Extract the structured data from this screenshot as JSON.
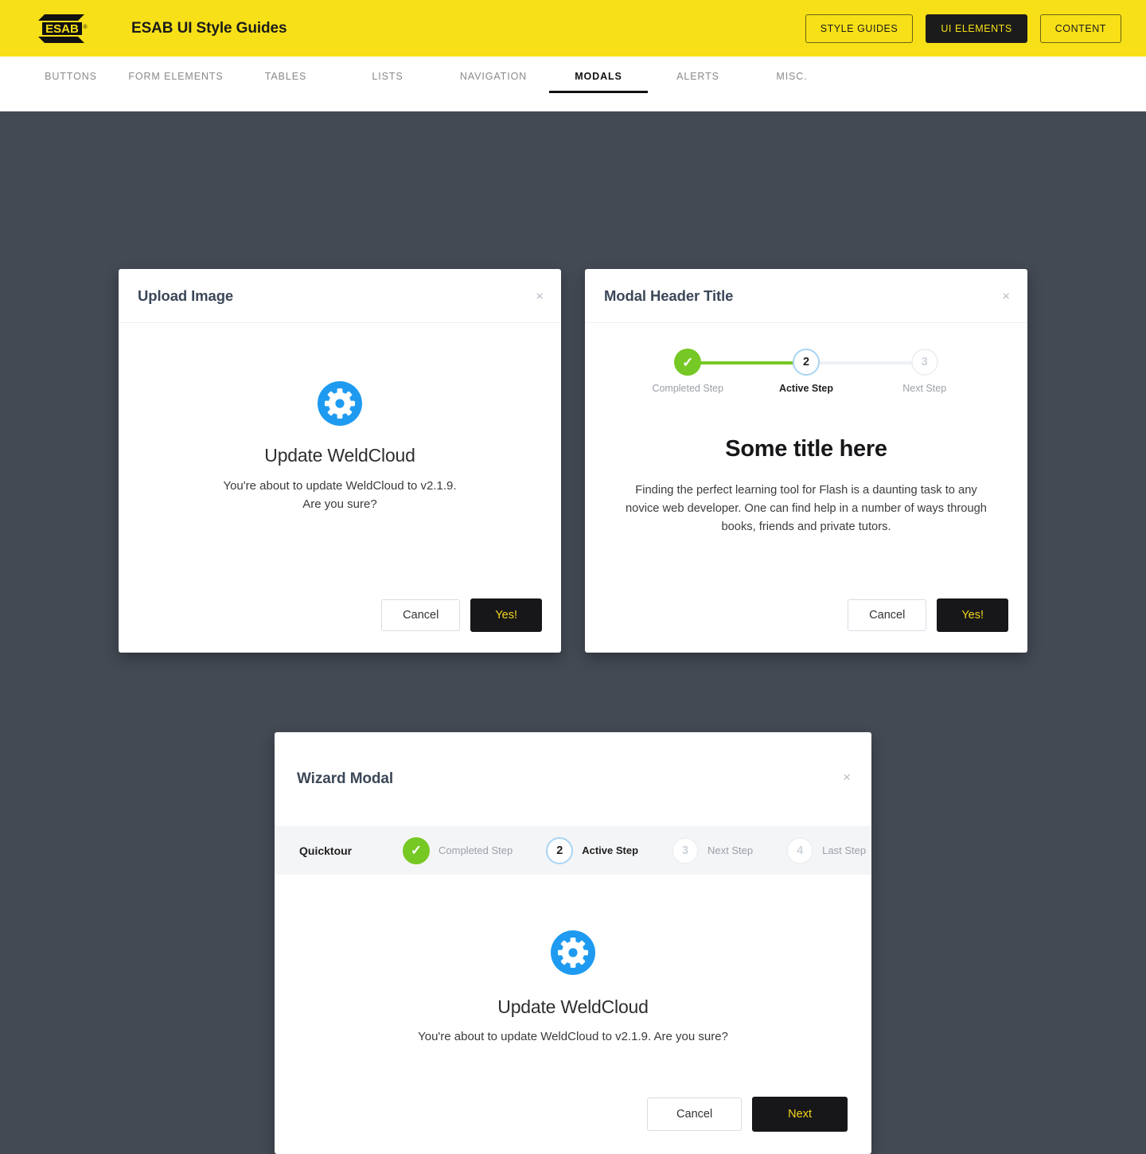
{
  "topbar": {
    "logo_text": "ESAB",
    "logo_tm": "®",
    "brand_title": "ESAB UI Style Guides",
    "buttons": [
      {
        "label": "STYLE GUIDES",
        "active": false
      },
      {
        "label": "UI ELEMENTS",
        "active": true
      },
      {
        "label": "CONTENT",
        "active": false
      }
    ],
    "bg_color": "#f7e017",
    "active_btn_bg": "#1b1b1b",
    "active_btn_color": "#f7e017"
  },
  "nav": {
    "tabs": [
      {
        "label": "BUTTONS",
        "active": false
      },
      {
        "label": "FORM ELEMENTS",
        "active": false
      },
      {
        "label": "TABLES",
        "active": false
      },
      {
        "label": "LISTS",
        "active": false
      },
      {
        "label": "NAVIGATION",
        "active": false
      },
      {
        "label": "MODALS",
        "active": true
      },
      {
        "label": "ALERTS",
        "active": false
      },
      {
        "label": "MISC.",
        "active": false
      }
    ]
  },
  "page": {
    "background_color": "#434a54"
  },
  "modal_upload": {
    "title": "Upload Image",
    "close_label": "×",
    "icon": "gear-icon",
    "icon_color": "#1e9bf0",
    "heading": "Update WeldCloud",
    "body_line_1": "You're about to update WeldCloud to v2.1.9.",
    "body_line_2": "Are you sure?",
    "cancel_label": "Cancel",
    "confirm_label": "Yes!"
  },
  "modal_header_title": {
    "title": "Modal Header Title",
    "close_label": "×",
    "stepper": {
      "steps": [
        {
          "marker": "✓",
          "label": "Completed Step",
          "state": "done"
        },
        {
          "marker": "2",
          "label": "Active Step",
          "state": "active"
        },
        {
          "marker": "3",
          "label": "Next Step",
          "state": "todo"
        }
      ],
      "done_color": "#76c824",
      "active_border_color": "#a8d4f3",
      "todo_color": "#eef1f4"
    },
    "heading": "Some title here",
    "paragraph": "Finding the perfect learning tool for Flash is a daunting task to any novice web developer. One can find help in a number of ways through books, friends and private tutors.",
    "cancel_label": "Cancel",
    "confirm_label": "Yes!"
  },
  "modal_wizard": {
    "title": "Wizard Modal",
    "close_label": "×",
    "wizard_label": "Quicktour",
    "steps": [
      {
        "marker": "✓",
        "label": "Completed Step",
        "state": "done"
      },
      {
        "marker": "2",
        "label": "Active Step",
        "state": "active"
      },
      {
        "marker": "3",
        "label": "Next Step",
        "state": "todo"
      },
      {
        "marker": "4",
        "label": "Last Step",
        "state": "todo"
      }
    ],
    "icon": "gear-icon",
    "icon_color": "#1e9bf0",
    "heading": "Update WeldCloud",
    "body_line_1": "You're about to update WeldCloud to v2.1.9. Are you sure?",
    "cancel_label": "Cancel",
    "next_label": "Next"
  }
}
